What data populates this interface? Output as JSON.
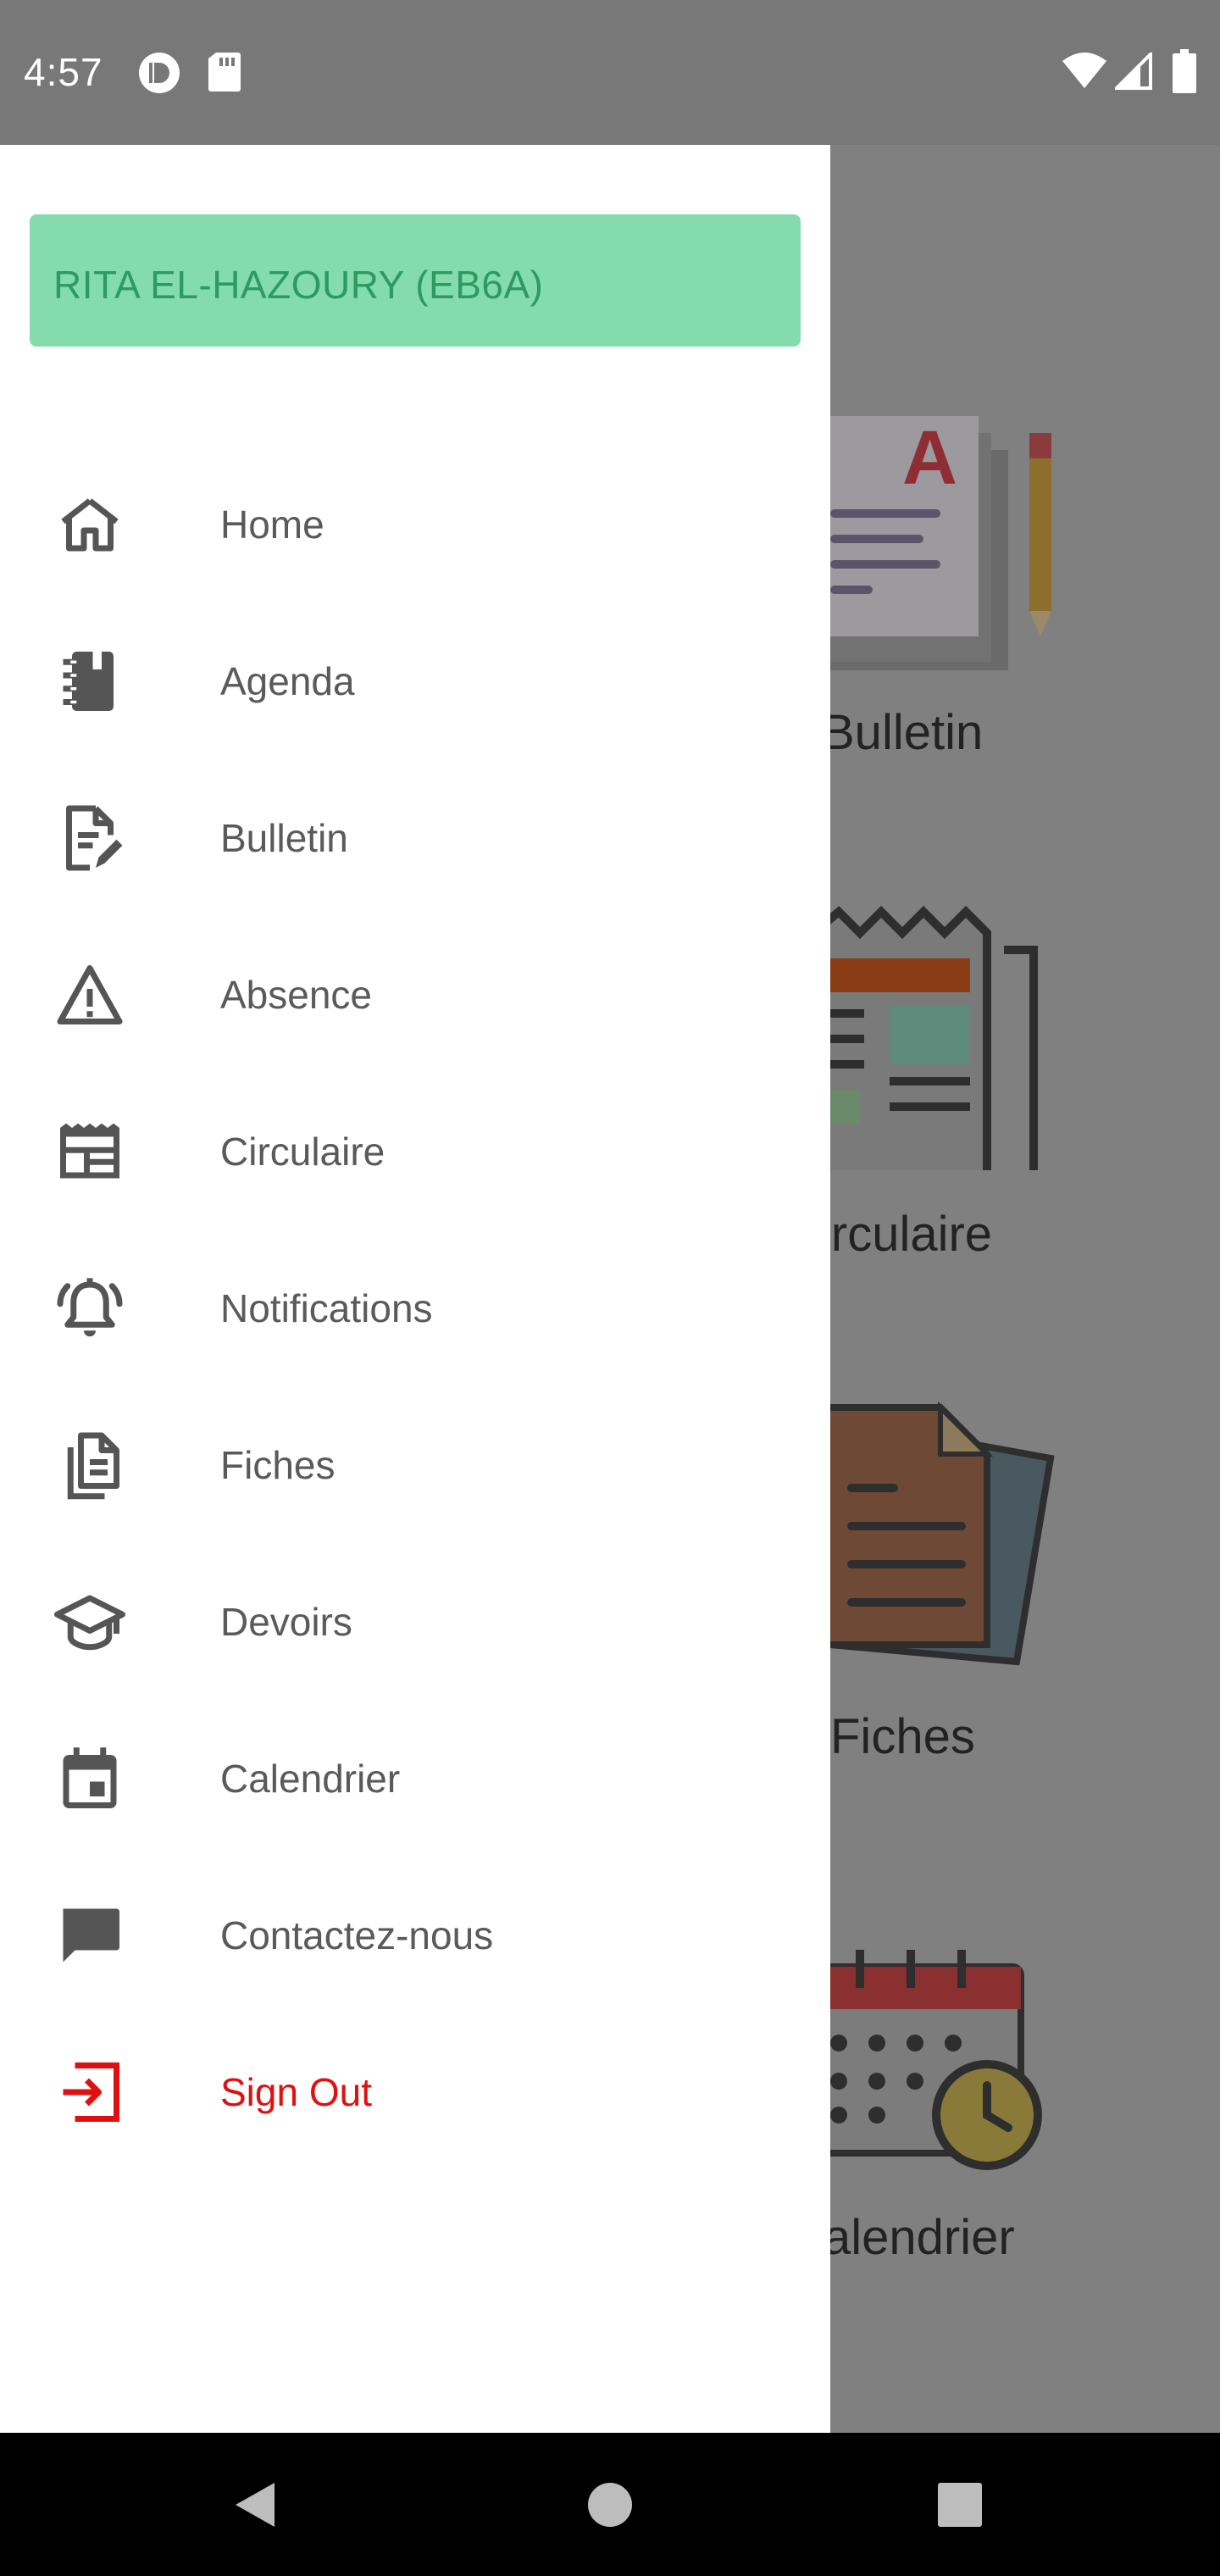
{
  "status_bar": {
    "time": "4:57",
    "icons": [
      "cloud-icon",
      "sd-card-icon",
      "wifi-icon",
      "signal-icon",
      "battery-icon"
    ]
  },
  "drawer": {
    "user_name": "RITA EL-HAZOURY (EB6A)",
    "items": [
      {
        "label": "Home",
        "icon": "home-icon"
      },
      {
        "label": "Agenda",
        "icon": "agenda-icon"
      },
      {
        "label": "Bulletin",
        "icon": "bulletin-icon"
      },
      {
        "label": "Absence",
        "icon": "warning-icon"
      },
      {
        "label": "Circulaire",
        "icon": "newspaper-icon"
      },
      {
        "label": "Notifications",
        "icon": "bell-icon"
      },
      {
        "label": "Fiches",
        "icon": "documents-icon"
      },
      {
        "label": "Devoirs",
        "icon": "graduation-cap-icon"
      },
      {
        "label": "Calendrier",
        "icon": "calendar-icon"
      },
      {
        "label": "Contactez-nous",
        "icon": "chat-icon"
      },
      {
        "label": "Sign Out",
        "icon": "sign-out-icon"
      }
    ]
  },
  "background_app": {
    "tiles": [
      "Bulletin",
      "irculaire",
      "Fiches",
      "alendrier"
    ]
  },
  "colors": {
    "accent_card": "#84dbad",
    "user_text": "#2c9a63",
    "menu_text": "#5a5a5a",
    "signout": "#e01010",
    "scrim": "#808080"
  }
}
